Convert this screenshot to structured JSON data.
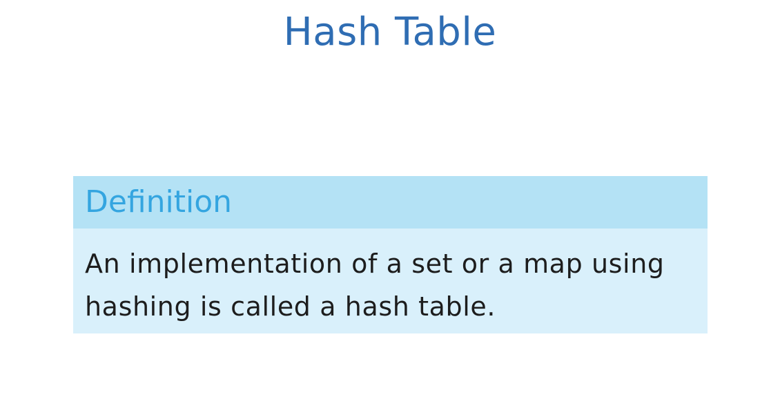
{
  "slide": {
    "title": "Hash Table",
    "definition": {
      "heading": "Definition",
      "text": "An implementation of a set or a map using hashing is called a hash table."
    }
  },
  "colors": {
    "title": "#2f6db3",
    "definition_header_bg": "#b4e2f5",
    "definition_heading": "#34a5e0",
    "definition_body_bg": "#d9f0fb",
    "body_text": "#1d1d1d"
  }
}
